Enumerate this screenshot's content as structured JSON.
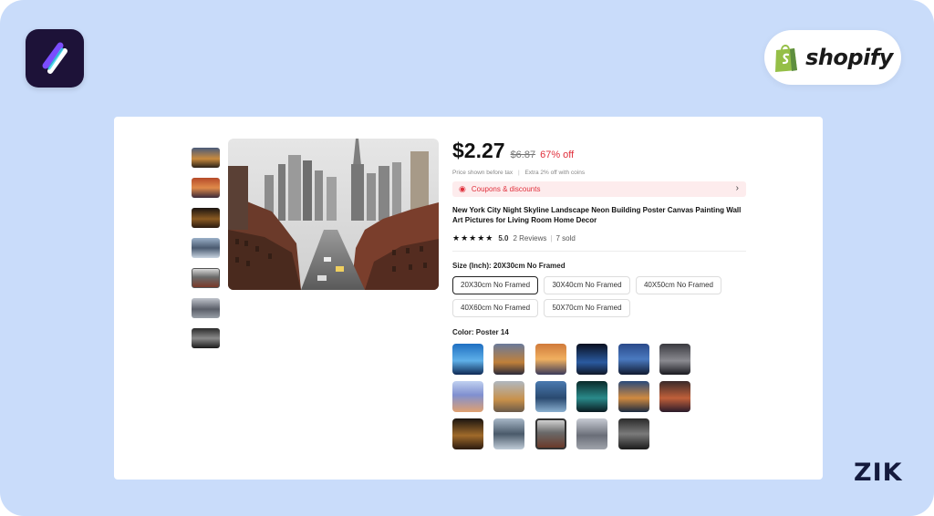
{
  "brand": {
    "shopify_text": "shopify",
    "watermark": "ZIK"
  },
  "gallery": {
    "thumbnail_count": 7,
    "selected_thumbnail": 5
  },
  "product": {
    "price": "$2.27",
    "original_price": "$6.87",
    "discount": "67% off",
    "tax_note": "Price shown before tax",
    "coins_note": "Extra 2% off with coins",
    "coupons_label": "Coupons & discounts",
    "title": "New York City Night Skyline Landscape Neon Building Poster Canvas Painting Wall Art Pictures for Living Room Home Decor",
    "rating": 5.0,
    "rating_text": "5.0",
    "stars": "★★★★★",
    "reviews": "2 Reviews",
    "sold": "7 sold"
  },
  "size": {
    "label": "Size (Inch): 20X30cm No Framed",
    "options": [
      "20X30cm No Framed",
      "30X40cm No Framed",
      "40X50cm No Framed",
      "40X60cm No Framed",
      "50X70cm No Framed"
    ],
    "selected": 0
  },
  "color": {
    "label": "Color: Poster 14",
    "swatch_count": 17,
    "selected": 14
  },
  "colors": {
    "price_red": "#e02f3b",
    "coupon_bg": "#fdeced",
    "page_bg": "#c9dcfa",
    "app_icon_bg": "#1d1238",
    "shopify_green": "#95bf47"
  },
  "icons": [
    "app-logo-icon",
    "shopify-bag-icon",
    "coupon-tag-icon",
    "chevron-right-icon",
    "star-icon"
  ]
}
